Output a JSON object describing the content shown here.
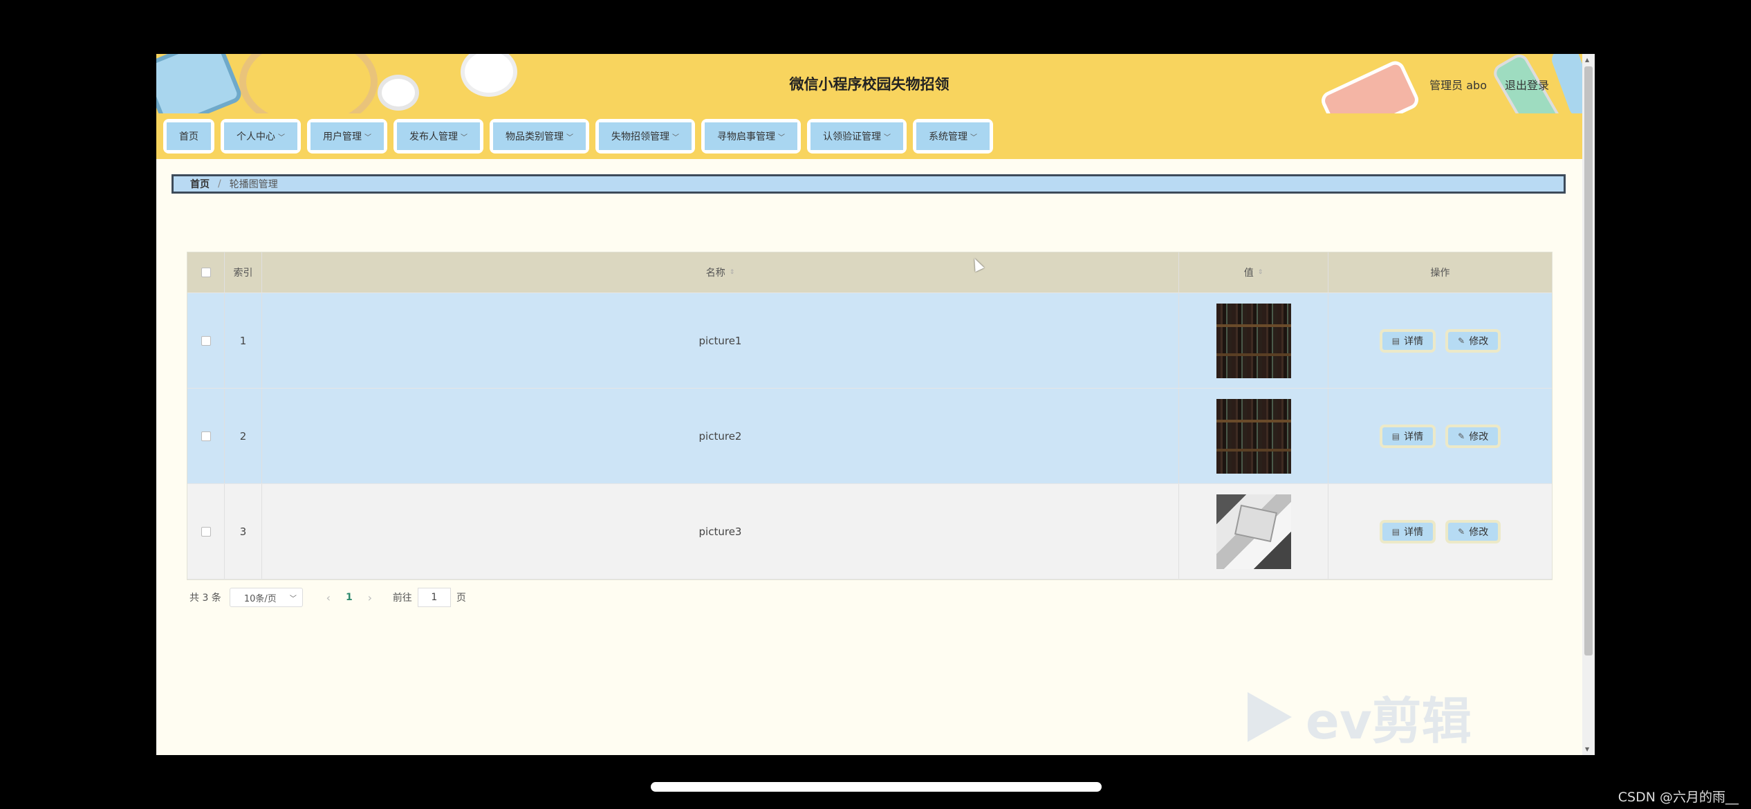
{
  "app": {
    "title": "微信小程序校园失物招领",
    "user_label": "管理员 abo",
    "logout_label": "退出登录"
  },
  "nav": {
    "items": [
      {
        "label": "首页",
        "has_dropdown": false
      },
      {
        "label": "个人中心",
        "has_dropdown": true
      },
      {
        "label": "用户管理",
        "has_dropdown": true
      },
      {
        "label": "发布人管理",
        "has_dropdown": true
      },
      {
        "label": "物品类别管理",
        "has_dropdown": true
      },
      {
        "label": "失物招领管理",
        "has_dropdown": true
      },
      {
        "label": "寻物启事管理",
        "has_dropdown": true
      },
      {
        "label": "认领验证管理",
        "has_dropdown": true
      },
      {
        "label": "系统管理",
        "has_dropdown": true
      }
    ]
  },
  "breadcrumb": {
    "home": "首页",
    "separator": "/",
    "current": "轮播图管理"
  },
  "table": {
    "columns": {
      "index": "索引",
      "name": "名称",
      "value": "值",
      "actions": "操作"
    },
    "rows": [
      {
        "index": "1",
        "name": "picture1",
        "thumb": "books"
      },
      {
        "index": "2",
        "name": "picture2",
        "thumb": "books"
      },
      {
        "index": "3",
        "name": "picture3",
        "thumb": "box"
      }
    ],
    "detail_label": "详情",
    "edit_label": "修改"
  },
  "pager": {
    "total": "共 3 条",
    "page_size": "10条/页",
    "current_page": "1",
    "goto_prefix": "前往",
    "goto_value": "1",
    "goto_suffix": "页"
  },
  "watermark": {
    "text": "ev剪辑"
  },
  "credit": "CSDN @六月的雨__",
  "colors": {
    "header_bg": "#f8d45e",
    "nav_button": "#a9d6f1",
    "row_selected": "#cde4f6",
    "table_header": "#dbd7c0",
    "page_bg": "#fffdf2"
  }
}
